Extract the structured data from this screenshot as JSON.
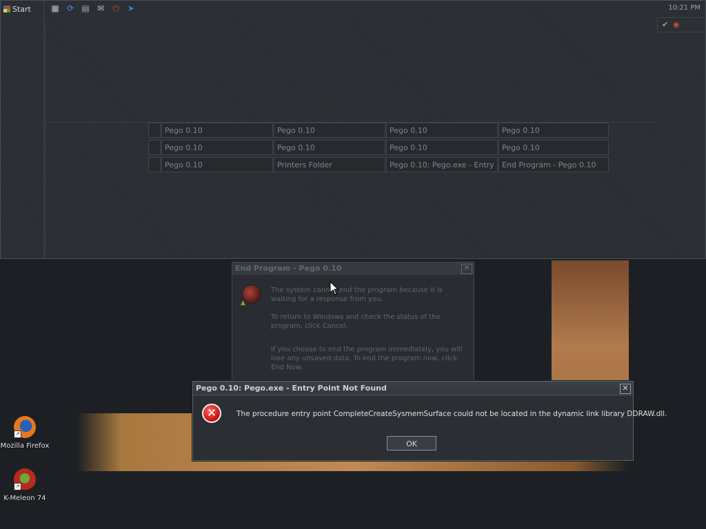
{
  "taskbar": {
    "start_label": "Start",
    "clock": "10:21 PM",
    "quicklaunch": [
      {
        "icon": "desktop-icon",
        "glyph": "▦"
      },
      {
        "icon": "refresh-icon",
        "glyph": "⟳"
      },
      {
        "icon": "folder-icon",
        "glyph": "▤"
      },
      {
        "icon": "mail-icon",
        "glyph": "✉"
      },
      {
        "icon": "power-icon",
        "glyph": "⏻"
      },
      {
        "icon": "arrow-icon",
        "glyph": "➤"
      }
    ],
    "tasks": {
      "row1": [
        "Pego 0.10",
        "Pego 0.10",
        "Pego 0.10",
        "Pego 0.10"
      ],
      "row2": [
        "Pego 0.10",
        "Pego 0.10",
        "Pego 0.10",
        "Pego 0.10"
      ],
      "row3": [
        "Pego 0.10",
        "Printers Folder",
        "Pego 0.10: Pego.exe - Entry ...",
        "End Program - Pego 0.10"
      ]
    }
  },
  "end_program_dialog": {
    "title": "End Program - Pego 0.10",
    "close_glyph": "✕",
    "para1": "The system cannot end the program because it is waiting for a response from you.",
    "para2": "To return to Windows and check the status of the program, click Cancel.",
    "para3": "If you choose to end the program immediately, you will lose any unsaved data. To end the program now, click End Now."
  },
  "error_dialog": {
    "title": "Pego 0.10: Pego.exe - Entry Point Not Found",
    "close_glyph": "✕",
    "icon_glyph": "✕",
    "message": "The procedure entry point CompleteCreateSysmemSurface could not be located in the dynamic link library DDRAW.dll.",
    "ok_label": "OK"
  },
  "desktop_icons": [
    {
      "label": "Mozilla Firefox",
      "icon": "firefox-icon"
    },
    {
      "label": "K-Meleon 74",
      "icon": "kmeleon-icon"
    }
  ],
  "colors": {
    "accent_error": "#d01818",
    "background": "#1c2024"
  }
}
